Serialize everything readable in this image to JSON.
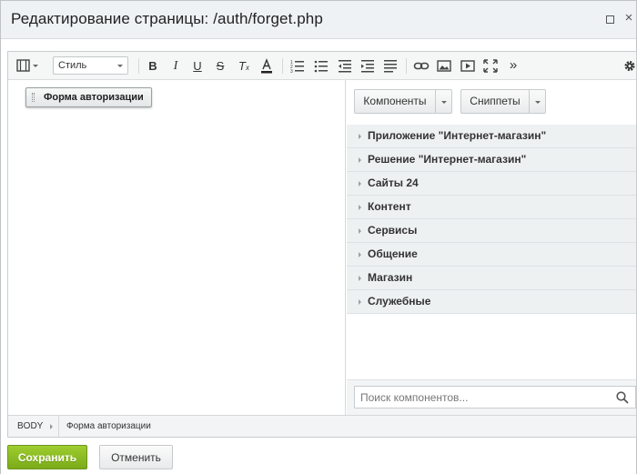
{
  "window": {
    "title": "Редактирование страницы: /auth/forget.php"
  },
  "toolbar": {
    "style_select": "Стиль",
    "icons": [
      "view-mode-icon",
      "bold-icon",
      "italic-icon",
      "underline-icon",
      "strikethrough-icon",
      "remove-format-icon",
      "text-color-icon",
      "ordered-list-icon",
      "unordered-list-icon",
      "outdent-icon",
      "indent-icon",
      "justify-icon",
      "link-icon",
      "image-icon",
      "video-icon",
      "fullscreen-icon",
      "more-icon",
      "settings-icon"
    ]
  },
  "content": {
    "component_chip": "Форма авторизации"
  },
  "panel": {
    "components_label": "Компоненты",
    "snippets_label": "Сниппеты",
    "tree": [
      "Приложение \"Интернет-магазин\"",
      "Решение \"Интернет-магазин\"",
      "Сайты 24",
      "Контент",
      "Сервисы",
      "Общение",
      "Магазин",
      "Служебные"
    ],
    "search_placeholder": "Поиск компонентов..."
  },
  "statusbar": {
    "crumb_root": "BODY",
    "crumb_current": "Форма авторизации"
  },
  "footer": {
    "save_label": "Сохранить",
    "cancel_label": "Отменить"
  },
  "colors": {
    "save_button": "#8dbd22",
    "titlebar_bg": "#eef2f4",
    "tree_item_bg": "#eef1f2"
  }
}
